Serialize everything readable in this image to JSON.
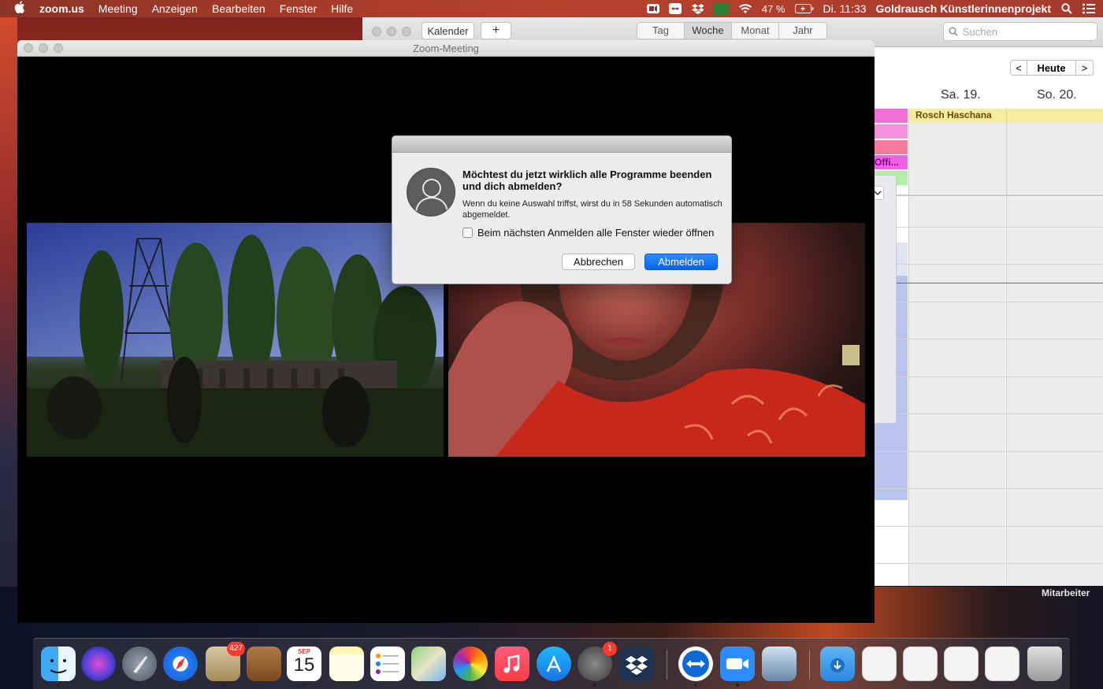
{
  "menubar": {
    "app_name": "zoom.us",
    "menus": [
      "Meeting",
      "Anzeigen",
      "Bearbeiten",
      "Fenster",
      "Hilfe"
    ],
    "battery": "47 %",
    "clock": "Di. 11:33",
    "user_name": "Goldrausch Künstlerinnenprojekt",
    "vpn_label": "VPN"
  },
  "calendar": {
    "calendars_button": "Kalender",
    "add_button": "+",
    "views": [
      "Tag",
      "Woche",
      "Monat",
      "Jahr"
    ],
    "active_view": "Woche",
    "search_placeholder": "Suchen",
    "nav_prev": "<",
    "today_button": "Heute",
    "nav_next": ">",
    "days": [
      "Sa. 19.",
      "So. 20."
    ],
    "allday_event": "Rosch Haschana",
    "partial_event": "Offi..."
  },
  "zoom": {
    "window_title": "Zoom-Meeting"
  },
  "dialog": {
    "title": "Möchtest du jetzt wirklich alle Programme beenden und dich abmelden?",
    "message": "Wenn du keine Auswahl triffst, wirst du in 58 Sekunden automatisch abgemeldet.",
    "checkbox_label": "Beim nächsten Anmelden alle Fenster wieder öffnen",
    "checkbox_checked": false,
    "cancel_label": "Abbrechen",
    "confirm_label": "Abmelden"
  },
  "desktop": {
    "label": "Mitarbeiter"
  },
  "dock": {
    "mail_badge": "427",
    "sysprefs_badge": "1",
    "calendar_month": "SEP",
    "calendar_day": "15",
    "apps": [
      "finder",
      "siri",
      "launchpad",
      "safari",
      "mail",
      "contacts",
      "calendar",
      "notes",
      "reminders",
      "maps",
      "photos",
      "music",
      "app-store",
      "system-preferences",
      "dropbox",
      "teamviewer",
      "zoom",
      "preview",
      "downloads",
      "documents",
      "trash"
    ]
  }
}
